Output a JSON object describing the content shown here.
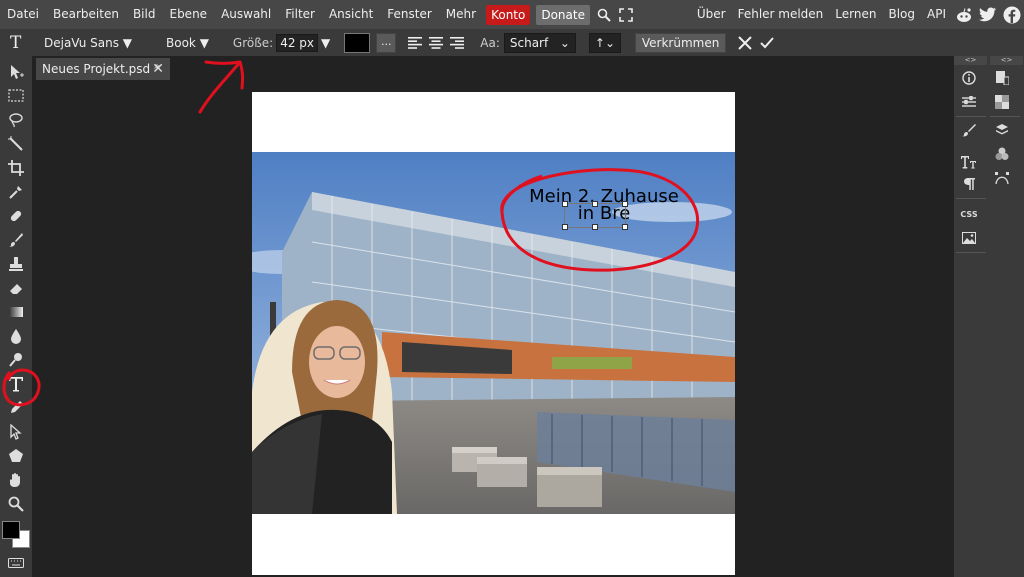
{
  "menubar": {
    "items": [
      "Datei",
      "Bearbeiten",
      "Bild",
      "Ebene",
      "Auswahl",
      "Filter",
      "Ansicht",
      "Fenster",
      "Mehr"
    ],
    "konto": "Konto",
    "donate": "Donate",
    "right_links": [
      "Über",
      "Fehler melden",
      "Lernen",
      "Blog",
      "API"
    ]
  },
  "options": {
    "tool_icon": "T",
    "font_family": "DejaVu Sans",
    "font_style": "Book",
    "size_label": "Größe:",
    "size_value": "42 px",
    "more_label": "...",
    "aa_label": "Aa:",
    "aa_value": "Scharf",
    "direction_value": "↑",
    "warp_label": "Verkrümmen"
  },
  "tabs": [
    {
      "label": "Neues Projekt.psd *"
    }
  ],
  "canvas": {
    "text_line1": "Mein 2. Zuhause",
    "text_line2": "in Bre"
  },
  "colors": {
    "accent": "#c71a1a",
    "foreground": "#000000",
    "background": "#ffffff",
    "annotation": "#e0101e"
  },
  "icons": {
    "tools": [
      "move-icon",
      "marquee-icon",
      "lasso-icon",
      "magic-wand-icon",
      "crop-icon",
      "eyedropper-icon",
      "healing-icon",
      "brush-icon",
      "stamp-icon",
      "eraser-icon",
      "gradient-icon",
      "blur-icon",
      "dodge-icon",
      "type-icon",
      "pen-icon",
      "path-select-icon",
      "shape-icon",
      "hand-icon",
      "zoom-icon"
    ],
    "social": [
      "reddit-icon",
      "twitter-icon",
      "facebook-icon"
    ]
  }
}
